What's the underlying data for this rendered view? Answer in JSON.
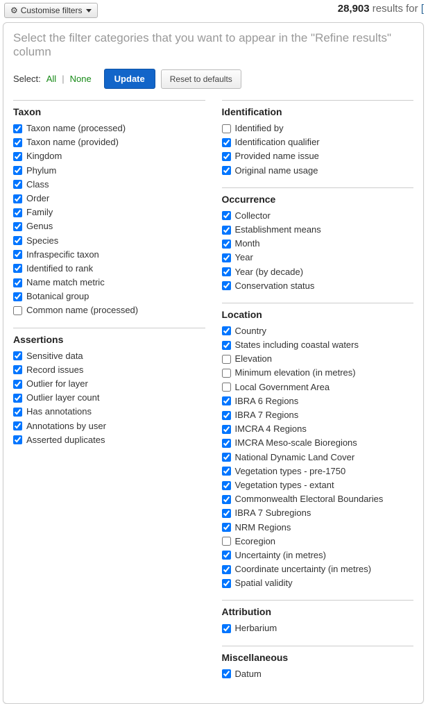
{
  "topbar": {
    "customise_label": "Customise filters",
    "results_count": "28,903",
    "results_label": "results for",
    "query_bracket": "["
  },
  "panel": {
    "description": "Select the filter categories that you want to appear in the \"Refine results\" column",
    "select_label": "Select:",
    "all_label": "All",
    "none_label": "None",
    "update_label": "Update",
    "reset_label": "Reset to defaults"
  },
  "left_groups": [
    {
      "title": "Taxon",
      "items": [
        {
          "label": "Taxon name (processed)",
          "checked": true
        },
        {
          "label": "Taxon name (provided)",
          "checked": true
        },
        {
          "label": "Kingdom",
          "checked": true
        },
        {
          "label": "Phylum",
          "checked": true
        },
        {
          "label": "Class",
          "checked": true
        },
        {
          "label": "Order",
          "checked": true
        },
        {
          "label": "Family",
          "checked": true
        },
        {
          "label": "Genus",
          "checked": true
        },
        {
          "label": "Species",
          "checked": true
        },
        {
          "label": "Infraspecific taxon",
          "checked": true
        },
        {
          "label": "Identified to rank",
          "checked": true
        },
        {
          "label": "Name match metric",
          "checked": true
        },
        {
          "label": "Botanical group",
          "checked": true
        },
        {
          "label": "Common name (processed)",
          "checked": false
        }
      ]
    },
    {
      "title": "Assertions",
      "items": [
        {
          "label": "Sensitive data",
          "checked": true
        },
        {
          "label": "Record issues",
          "checked": true
        },
        {
          "label": "Outlier for layer",
          "checked": true
        },
        {
          "label": "Outlier layer count",
          "checked": true
        },
        {
          "label": "Has annotations",
          "checked": true
        },
        {
          "label": "Annotations by user",
          "checked": true
        },
        {
          "label": "Asserted duplicates",
          "checked": true
        }
      ]
    }
  ],
  "right_groups": [
    {
      "title": "Identification",
      "items": [
        {
          "label": "Identified by",
          "checked": false
        },
        {
          "label": "Identification qualifier",
          "checked": true
        },
        {
          "label": "Provided name issue",
          "checked": true
        },
        {
          "label": "Original name usage",
          "checked": true
        }
      ]
    },
    {
      "title": "Occurrence",
      "items": [
        {
          "label": "Collector",
          "checked": true
        },
        {
          "label": "Establishment means",
          "checked": true
        },
        {
          "label": "Month",
          "checked": true
        },
        {
          "label": "Year",
          "checked": true
        },
        {
          "label": "Year (by decade)",
          "checked": true
        },
        {
          "label": "Conservation status",
          "checked": true
        }
      ]
    },
    {
      "title": "Location",
      "items": [
        {
          "label": "Country",
          "checked": true
        },
        {
          "label": "States including coastal waters",
          "checked": true
        },
        {
          "label": "Elevation",
          "checked": false
        },
        {
          "label": "Minimum elevation (in metres)",
          "checked": false
        },
        {
          "label": "Local Government Area",
          "checked": false
        },
        {
          "label": "IBRA 6 Regions",
          "checked": true
        },
        {
          "label": "IBRA 7 Regions",
          "checked": true
        },
        {
          "label": "IMCRA 4 Regions",
          "checked": true
        },
        {
          "label": "IMCRA Meso-scale Bioregions",
          "checked": true
        },
        {
          "label": "National Dynamic Land Cover",
          "checked": true
        },
        {
          "label": "Vegetation types - pre-1750",
          "checked": true
        },
        {
          "label": "Vegetation types - extant",
          "checked": true
        },
        {
          "label": "Commonwealth Electoral Boundaries",
          "checked": true
        },
        {
          "label": "IBRA 7 Subregions",
          "checked": true
        },
        {
          "label": "NRM Regions",
          "checked": true
        },
        {
          "label": "Ecoregion",
          "checked": false
        },
        {
          "label": "Uncertainty (in metres)",
          "checked": true
        },
        {
          "label": "Coordinate uncertainty (in metres)",
          "checked": true
        },
        {
          "label": "Spatial validity",
          "checked": true
        }
      ]
    },
    {
      "title": "Attribution",
      "items": [
        {
          "label": "Herbarium",
          "checked": true
        }
      ]
    },
    {
      "title": "Miscellaneous",
      "items": [
        {
          "label": "Datum",
          "checked": true
        }
      ]
    }
  ]
}
